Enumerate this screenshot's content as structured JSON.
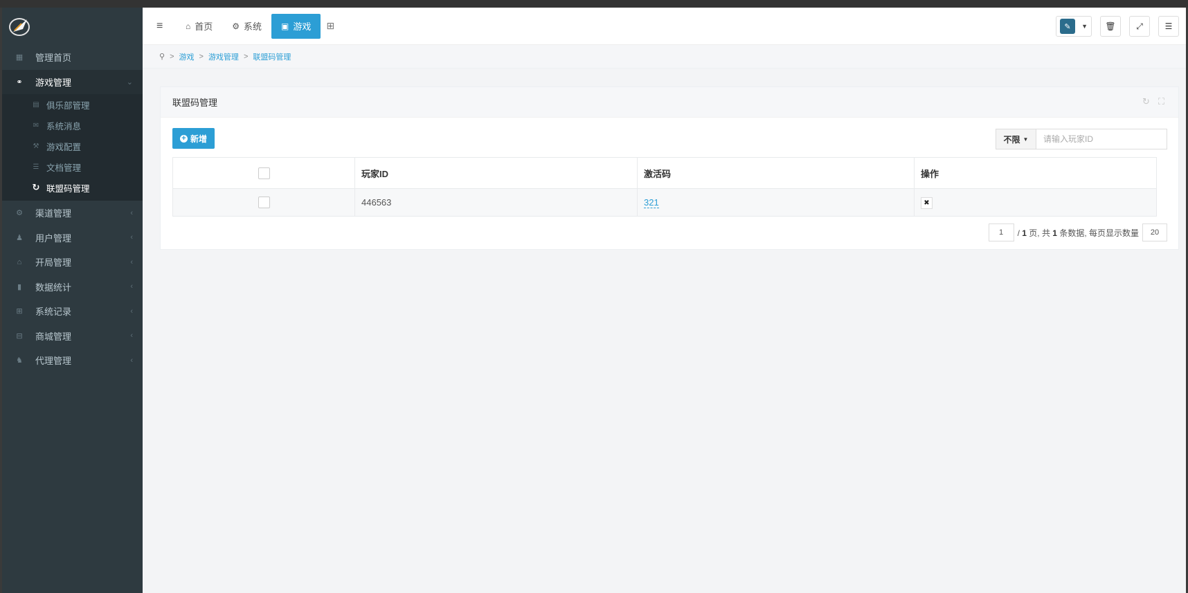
{
  "sidebar": {
    "items": [
      {
        "label": "管理首页",
        "icon": "dashboard-icon"
      },
      {
        "label": "游戏管理",
        "icon": "gamepad-icon",
        "open": true
      },
      {
        "label": "渠道管理",
        "icon": "cogs-icon"
      },
      {
        "label": "用户管理",
        "icon": "user-icon"
      },
      {
        "label": "开局管理",
        "icon": "home-icon"
      },
      {
        "label": "数据统计",
        "icon": "bar-chart-icon"
      },
      {
        "label": "系统记录",
        "icon": "windows-icon"
      },
      {
        "label": "商城管理",
        "icon": "shop-icon"
      },
      {
        "label": "代理管理",
        "icon": "users-icon"
      }
    ],
    "submenu": [
      {
        "label": "俱乐部管理",
        "icon": "club-icon"
      },
      {
        "label": "系统消息",
        "icon": "envelope-icon"
      },
      {
        "label": "游戏配置",
        "icon": "wrench-icon"
      },
      {
        "label": "文档管理",
        "icon": "list-icon"
      },
      {
        "label": "联盟码管理",
        "icon": "refresh-icon",
        "active": true
      }
    ]
  },
  "navbar": {
    "tabs": [
      {
        "label": "首页",
        "icon": "home-icon"
      },
      {
        "label": "系统",
        "icon": "gear-icon"
      },
      {
        "label": "游戏",
        "icon": "game-icon",
        "active": true
      }
    ]
  },
  "breadcrumb": [
    "游戏",
    "游戏管理",
    "联盟码管理"
  ],
  "panel": {
    "title": "联盟码管理",
    "add_label": "新增",
    "filter_label": "不限",
    "search_placeholder": "请输入玩家ID"
  },
  "table": {
    "columns": [
      "玩家ID",
      "激活码",
      "操作"
    ],
    "rows": [
      {
        "player_id": "446563",
        "code": "321"
      }
    ]
  },
  "pager": {
    "page": "1",
    "total_pages": "1",
    "text_pages": "/ ",
    "text_mid": " 页, 共 ",
    "total_records": "1",
    "text_end": " 条数据, 每页显示数量",
    "page_size": "20"
  },
  "colors": {
    "accent": "#2c9ed5",
    "sidebar_bg": "#2e3a40"
  }
}
